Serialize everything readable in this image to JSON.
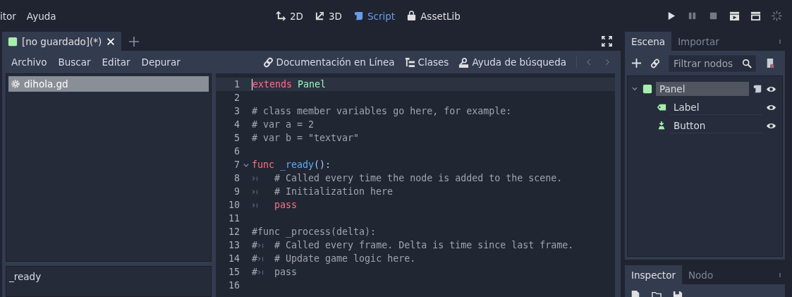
{
  "menu": [
    {
      "label": "itor"
    },
    {
      "label": "Ayuda"
    }
  ],
  "workspaces": [
    {
      "kind": "plane",
      "label": "2D",
      "selected": false
    },
    {
      "kind": "space",
      "label": "3D",
      "selected": false
    },
    {
      "kind": "script",
      "label": "Script",
      "selected": true
    },
    {
      "kind": "assetlib",
      "label": "AssetLib",
      "selected": false
    }
  ],
  "playback": [
    {
      "kind": "play",
      "disabled": false
    },
    {
      "kind": "pause",
      "disabled": true
    },
    {
      "kind": "stop",
      "disabled": true
    },
    {
      "kind": "playscene",
      "disabled": false
    },
    {
      "kind": "playcustom",
      "disabled": false
    },
    {
      "kind": "spinner",
      "disabled": true
    }
  ],
  "script_editor": {
    "tabs": [
      {
        "label": "[no guardado](*)",
        "selected": true
      }
    ],
    "menus": [
      {
        "label": "Archivo"
      },
      {
        "label": "Buscar"
      },
      {
        "label": "Editar"
      },
      {
        "label": "Depurar"
      }
    ],
    "tools": [
      {
        "kind": "docs",
        "label": "Documentación en Línea"
      },
      {
        "kind": "classes",
        "label": "Clases"
      },
      {
        "kind": "searchhelp",
        "label": "Ayuda de búsqueda"
      }
    ],
    "scripts": [
      {
        "label": "dihola.gd",
        "selected": true
      }
    ],
    "methods": [
      {
        "label": "_ready"
      }
    ],
    "code": [
      {
        "number": "1",
        "current": true,
        "foldable": false,
        "tokens": [
          {
            "kind": "keyword",
            "text": "extends"
          },
          {
            "kind": "type",
            "text": " Panel"
          }
        ]
      },
      {
        "number": "2",
        "current": false,
        "foldable": false
      },
      {
        "number": "3",
        "current": false,
        "foldable": false,
        "tokens": [
          {
            "kind": "comment",
            "text": "# class member variables go here, for example:"
          }
        ]
      },
      {
        "number": "4",
        "current": false,
        "foldable": false,
        "tokens": [
          {
            "kind": "comment",
            "text": "# var a = 2"
          }
        ]
      },
      {
        "number": "5",
        "current": false,
        "foldable": false,
        "tokens": [
          {
            "kind": "comment",
            "text": "# var b = \"textvar\""
          }
        ]
      },
      {
        "number": "6",
        "current": false,
        "foldable": false
      },
      {
        "number": "7",
        "current": false,
        "foldable": true,
        "tokens": [
          {
            "kind": "keyword",
            "text": "func"
          },
          {
            "kind": "function",
            "text": " _ready"
          },
          {
            "kind": "symbol",
            "text": "():"
          }
        ]
      },
      {
        "number": "8",
        "current": false,
        "foldable": false,
        "tokens": [
          {
            "kind": "tab"
          },
          {
            "kind": "comment",
            "text": "# Called every time the node is added to the scene."
          }
        ]
      },
      {
        "number": "9",
        "current": false,
        "foldable": false,
        "tokens": [
          {
            "kind": "tab"
          },
          {
            "kind": "comment",
            "text": "# Initialization here"
          }
        ]
      },
      {
        "number": "10",
        "current": false,
        "foldable": false,
        "tokens": [
          {
            "kind": "tab"
          },
          {
            "kind": "keyword",
            "text": "pass"
          }
        ]
      },
      {
        "number": "11",
        "current": false,
        "foldable": false
      },
      {
        "number": "12",
        "current": false,
        "foldable": false,
        "tokens": [
          {
            "kind": "comment",
            "text": "#func _process(delta):"
          }
        ]
      },
      {
        "number": "13",
        "current": false,
        "foldable": false,
        "tokens": [
          {
            "kind": "comment",
            "text": "#"
          },
          {
            "kind": "tab"
          },
          {
            "kind": "comment",
            "text": "# Called every frame. Delta is time since last frame."
          }
        ]
      },
      {
        "number": "14",
        "current": false,
        "foldable": false,
        "tokens": [
          {
            "kind": "comment",
            "text": "#"
          },
          {
            "kind": "tab"
          },
          {
            "kind": "comment",
            "text": "# Update game logic here."
          }
        ]
      },
      {
        "number": "15",
        "current": false,
        "foldable": false,
        "tokens": [
          {
            "kind": "comment",
            "text": "#"
          },
          {
            "kind": "tab"
          },
          {
            "kind": "comment",
            "text": "pass"
          }
        ]
      },
      {
        "number": "16",
        "current": false,
        "foldable": false
      }
    ]
  },
  "dock": {
    "top_tabs": [
      {
        "label": "Escena",
        "selected": true
      },
      {
        "label": "Importar",
        "selected": false
      }
    ],
    "filter": {
      "placeholder": "Filtrar nodos"
    },
    "tree": [
      {
        "kind": "panel",
        "label": "Panel",
        "selected": true,
        "expanded": true,
        "script": true,
        "visible": true,
        "children": [
          {
            "kind": "label",
            "label": "Label",
            "selected": false,
            "script": false,
            "visible": true
          },
          {
            "kind": "button",
            "label": "Button",
            "selected": false,
            "script": false,
            "visible": true
          }
        ]
      }
    ],
    "bottom_tabs": [
      {
        "label": "Inspector",
        "selected": true
      },
      {
        "label": "Nodo",
        "selected": false
      }
    ]
  }
}
